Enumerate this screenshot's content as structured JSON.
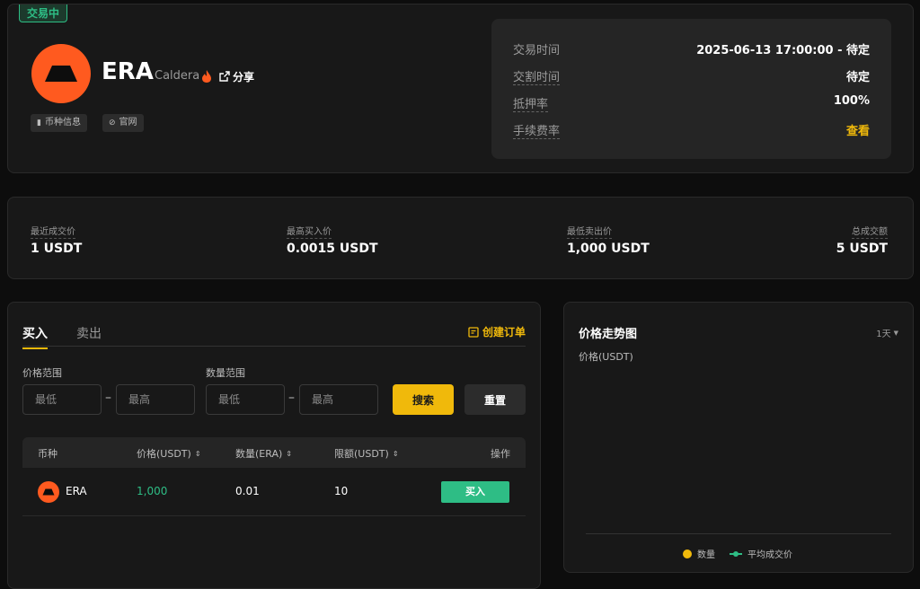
{
  "header": {
    "status_tag": "交易中",
    "token_symbol": "ERA",
    "token_name": "Caldera",
    "share_label": "分享",
    "pill_info": "币种信息",
    "pill_site": "官网",
    "logo_color": "#ff5a1f"
  },
  "schedule": {
    "rows": [
      {
        "key": "交易时间",
        "value": "2025-06-13 17:00:00 - 待定"
      },
      {
        "key": "交割时间",
        "value": "待定"
      },
      {
        "key": "抵押率",
        "value": "100%"
      },
      {
        "key": "手续费率",
        "value": "查看"
      }
    ]
  },
  "stats": {
    "last_price_label": "最近成交价",
    "last_price": "1 USDT",
    "best_bid_label": "最高买入价",
    "best_bid": "0.0015 USDT",
    "best_ask_label": "最低卖出价",
    "best_ask": "1,000 USDT",
    "volume_label": "总成交额",
    "volume": "5 USDT"
  },
  "orders": {
    "tab_buy": "买入",
    "tab_sell": "卖出",
    "create_order": "创建订单",
    "price_range_label": "价格范围",
    "qty_range_label": "数量范围",
    "min_placeholder": "最低",
    "max_placeholder": "最高",
    "dash": "–",
    "search": "搜索",
    "reset": "重置",
    "columns": [
      "币种",
      "价格(USDT)",
      "数量(ERA)",
      "限额(USDT)",
      "操作"
    ],
    "rows": [
      {
        "token": "ERA",
        "price": "1,000",
        "quantity": "0.01",
        "limit": "10",
        "action": "买入"
      }
    ]
  },
  "chart": {
    "title": "价格走势图",
    "range": "1天",
    "ylabel": "价格(USDT)",
    "legend_quantity": "数量",
    "legend_avg": "平均成交价",
    "accent": "#f0b90b",
    "green": "#2ebd85"
  }
}
